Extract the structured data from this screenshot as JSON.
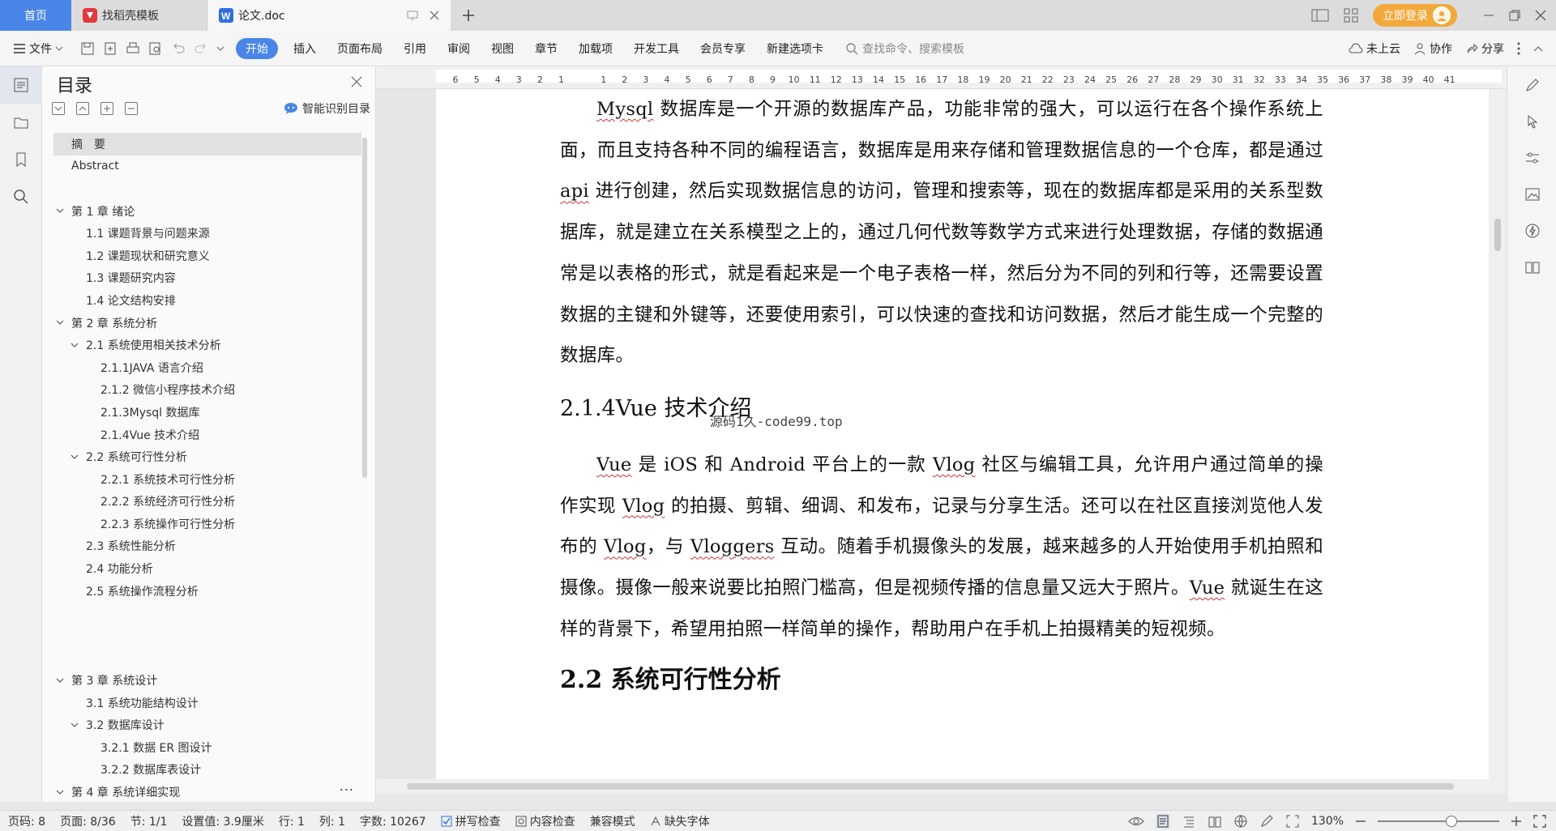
{
  "titlebar": {
    "home_tab": "首页",
    "template_tab": "找稻壳模板",
    "doc_tab": "论文.doc",
    "login_label": "立即登录",
    "colors": {
      "accent": "#4a86e8",
      "login": "#f2a93b",
      "template_icon": "#e0393e"
    }
  },
  "ribbon": {
    "file_label": "文件",
    "menus": [
      "开始",
      "插入",
      "页面布局",
      "引用",
      "审阅",
      "视图",
      "章节",
      "加载项",
      "开发工具",
      "会员专享",
      "新建选项卡"
    ],
    "search_placeholder": "查找命令、搜索模板",
    "cloud_label": "未上云",
    "collab_label": "协作",
    "share_label": "分享"
  },
  "toc": {
    "title": "目录",
    "smart_label": "智能识别目录",
    "more": "...",
    "items": [
      {
        "label": "摘　要",
        "level": 0,
        "caret": ""
      },
      {
        "label": "Abstract",
        "level": 0,
        "caret": ""
      },
      {
        "label": "",
        "level": 0,
        "caret": ""
      },
      {
        "label": "第 1 章  绪论",
        "level": 0,
        "caret": "v"
      },
      {
        "label": "1.1 课题背景与问题来源",
        "level": 1,
        "caret": ""
      },
      {
        "label": "1.2 课题现状和研究意义",
        "level": 1,
        "caret": ""
      },
      {
        "label": "1.3 课题研究内容",
        "level": 1,
        "caret": ""
      },
      {
        "label": "1.4 论文结构安排",
        "level": 1,
        "caret": ""
      },
      {
        "label": "第 2 章  系统分析",
        "level": 0,
        "caret": "v"
      },
      {
        "label": "2.1 系统使用相关技术分析",
        "level": 1,
        "caret": "v"
      },
      {
        "label": "2.1.1JAVA 语言介绍",
        "level": 2,
        "caret": ""
      },
      {
        "label": "2.1.2 微信小程序技术介绍",
        "level": 2,
        "caret": ""
      },
      {
        "label": "2.1.3Mysql 数据库",
        "level": 2,
        "caret": ""
      },
      {
        "label": "2.1.4Vue 技术介绍",
        "level": 2,
        "caret": ""
      },
      {
        "label": "2.2 系统可行性分析",
        "level": 1,
        "caret": "v"
      },
      {
        "label": "2.2.1 系统技术可行性分析",
        "level": 2,
        "caret": ""
      },
      {
        "label": "2.2.2 系统经济可行性分析",
        "level": 2,
        "caret": ""
      },
      {
        "label": "2.2.3 系统操作可行性分析",
        "level": 2,
        "caret": ""
      },
      {
        "label": "2.3 系统性能分析",
        "level": 1,
        "caret": ""
      },
      {
        "label": "2.4 功能分析",
        "level": 1,
        "caret": ""
      },
      {
        "label": "2.5 系统操作流程分析",
        "level": 1,
        "caret": ""
      },
      {
        "label": "",
        "level": 0,
        "caret": ""
      },
      {
        "label": "",
        "level": 0,
        "caret": ""
      },
      {
        "label": "",
        "level": 0,
        "caret": ""
      },
      {
        "label": "第 3 章  系统设计",
        "level": 0,
        "caret": "v"
      },
      {
        "label": "3.1 系统功能结构设计",
        "level": 1,
        "caret": ""
      },
      {
        "label": "3.2 数据库设计",
        "level": 1,
        "caret": "v"
      },
      {
        "label": "3.2.1 数据 ER 图设计",
        "level": 2,
        "caret": ""
      },
      {
        "label": "3.2.2 数据库表设计",
        "level": 2,
        "caret": ""
      },
      {
        "label": "第 4 章  系统详细实现",
        "level": 0,
        "caret": "v"
      }
    ]
  },
  "ruler": {
    "labels": [
      "6",
      "5",
      "4",
      "3",
      "2",
      "1",
      "",
      "1",
      "2",
      "3",
      "4",
      "5",
      "6",
      "7",
      "8",
      "9",
      "10",
      "11",
      "12",
      "13",
      "14",
      "15",
      "16",
      "17",
      "18",
      "19",
      "20",
      "21",
      "22",
      "23",
      "24",
      "25",
      "26",
      "27",
      "28",
      "29",
      "30",
      "31",
      "32",
      "33",
      "34",
      "35",
      "36",
      "37",
      "38",
      "39",
      "40",
      "41"
    ]
  },
  "document": {
    "p1_a": "Mysql",
    "p1_b": " 数据库是一个开源的数据库产品，功能非常的强大，可以运行在各个操作系统上面，而且支持各种不同的编程语言，数据库是用来存储和管理数据信息的一个仓库，都是通过 ",
    "p1_c": "api",
    "p1_d": " 进行创建，然后实现数据信息的访问，管理和搜索等，现在的数据库都是采用的关系型数据库，就是建立在关系模型之上的，通过几何代数等数学方式来进行处理数据，存储的数据通常是以表格的形式，就是看起来是一个电子表格一样，然后分为不同的列和行等，还需要设置数据的主键和外键等，还要使用索引，可以快速的查找和访问数据，然后才能生成一个完整的数据库。",
    "h_vue": "2.1.4Vue 技术介绍",
    "watermark": "源码1久-code99.top",
    "p2_a": "Vue",
    "p2_b": " 是 iOS 和 Android 平台上的一款 ",
    "p2_c": "Vlog",
    "p2_d": " 社区与编辑工具，允许用户通过简单的操作实现 ",
    "p2_e": "Vlog",
    "p2_f": " 的拍摄、剪辑、细调、和发布，记录与分享生活。还可以在社区直接浏览他人发布的 ",
    "p2_g": "Vlog",
    "p2_h": "，与 ",
    "p2_i": "Vloggers",
    "p2_j": " 互动。随着手机摄像头的发展，越来越多的人开始使用手机拍照和摄像。摄像一般来说要比拍照门槛高，但是视频传播的信息量又远大于照片。",
    "p2_k": "Vue",
    "p2_l": " 就诞生在这样的背景下，希望用拍照一样简单的操作，帮助用户在手机上拍摄精美的短视频。",
    "h_feas": "2.2 系统可行性分析"
  },
  "status": {
    "page_code": "页码: 8",
    "page": "页面: 8/36",
    "section": "节: 1/1",
    "setting": "设置值: 3.9厘米",
    "row": "行: 1",
    "col": "列: 1",
    "words": "字数: 10267",
    "spell": "拼写检查",
    "content_check": "内容检查",
    "compat": "兼容模式",
    "missing_font": "缺失字体",
    "zoom": "130%",
    "zoom_level": 0.6
  }
}
